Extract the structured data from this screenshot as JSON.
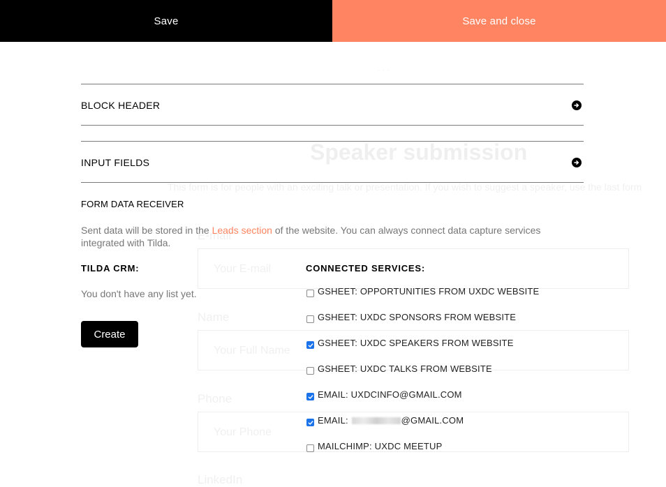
{
  "topbar": {
    "save_label": "Save",
    "save_close_label": "Save and close",
    "colors": {
      "save_bg": "#000000",
      "save_close_bg": "#ff8562"
    }
  },
  "background_preview": {
    "title": "Speaker submission",
    "description": "This form is for people with an exciting talk or presentation. If you wish to suggest a speaker, use the last form",
    "fields": [
      {
        "label": "E-mail",
        "placeholder": "Your E-mail"
      },
      {
        "label": "Name",
        "placeholder": "Your Full Name"
      },
      {
        "label": "Phone",
        "placeholder": "Your Phone"
      },
      {
        "label": "LinkedIn"
      }
    ]
  },
  "sections": [
    {
      "title": "BLOCK HEADER",
      "icon": "arrow-right-circle-icon"
    },
    {
      "title": "INPUT FIELDS",
      "icon": "arrow-right-circle-icon"
    }
  ],
  "form_data_receiver": {
    "title": "FORM DATA RECEIVER",
    "desc_before": "Sent data will be stored in the ",
    "link": "Leads section",
    "desc_after": " of the website. You can always connect data capture services integrated with Tilda.",
    "link_color": "#ff8562"
  },
  "tilda_crm": {
    "title": "TILDA CRM:",
    "empty_text": "You don't have any list yet.",
    "create_label": "Create"
  },
  "connected_services": {
    "title": "CONNECTED SERVICES:",
    "checked_color": "#1a73e8",
    "items": [
      {
        "label": "GSHEET: OPPORTUNITIES FROM UXDC WEBSITE",
        "checked": false
      },
      {
        "label": "GSHEET: UXDC SPONSORS FROM WEBSITE",
        "checked": false
      },
      {
        "label": "GSHEET: UXDC SPEAKERS FROM WEBSITE",
        "checked": true
      },
      {
        "label": "GSHEET: UXDC TALKS FROM WEBSITE",
        "checked": false
      },
      {
        "label": "EMAIL: UXDCINFO@GMAIL.COM",
        "checked": true
      },
      {
        "label_prefix": "EMAIL: ",
        "label_suffix": "@GMAIL.COM",
        "redacted": true,
        "checked": true
      },
      {
        "label": "MAILCHIMP: UXDC MEETUP",
        "checked": false
      }
    ]
  }
}
